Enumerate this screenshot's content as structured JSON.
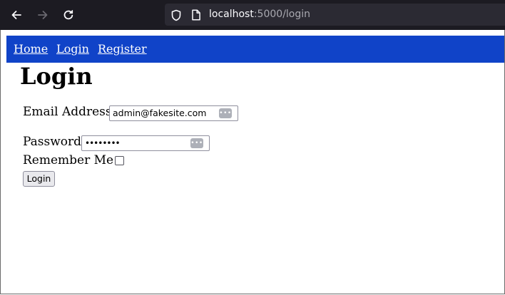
{
  "browser": {
    "url_host": "localhost",
    "url_rest": ":5000/login",
    "icons": {
      "back": "arrow-left-icon",
      "forward": "arrow-right-icon",
      "reload": "reload-icon",
      "tracking": "shield-icon",
      "page": "page-icon"
    },
    "colors": {
      "chrome": "#1c1b22",
      "urlbar": "#2b2a33"
    }
  },
  "site_nav": {
    "background": "#1043c8",
    "links": [
      {
        "label": "Home"
      },
      {
        "label": "Login"
      },
      {
        "label": "Register"
      }
    ]
  },
  "login_form": {
    "title": "Login",
    "email": {
      "label": "Email Address",
      "value": "admin@fakesite.com"
    },
    "password": {
      "label": "Password",
      "value_masked": "••••••••"
    },
    "remember": {
      "label": "Remember Me",
      "checked": false
    },
    "submit_label": "Login",
    "password_manager_icon": "password-manager-icon"
  }
}
